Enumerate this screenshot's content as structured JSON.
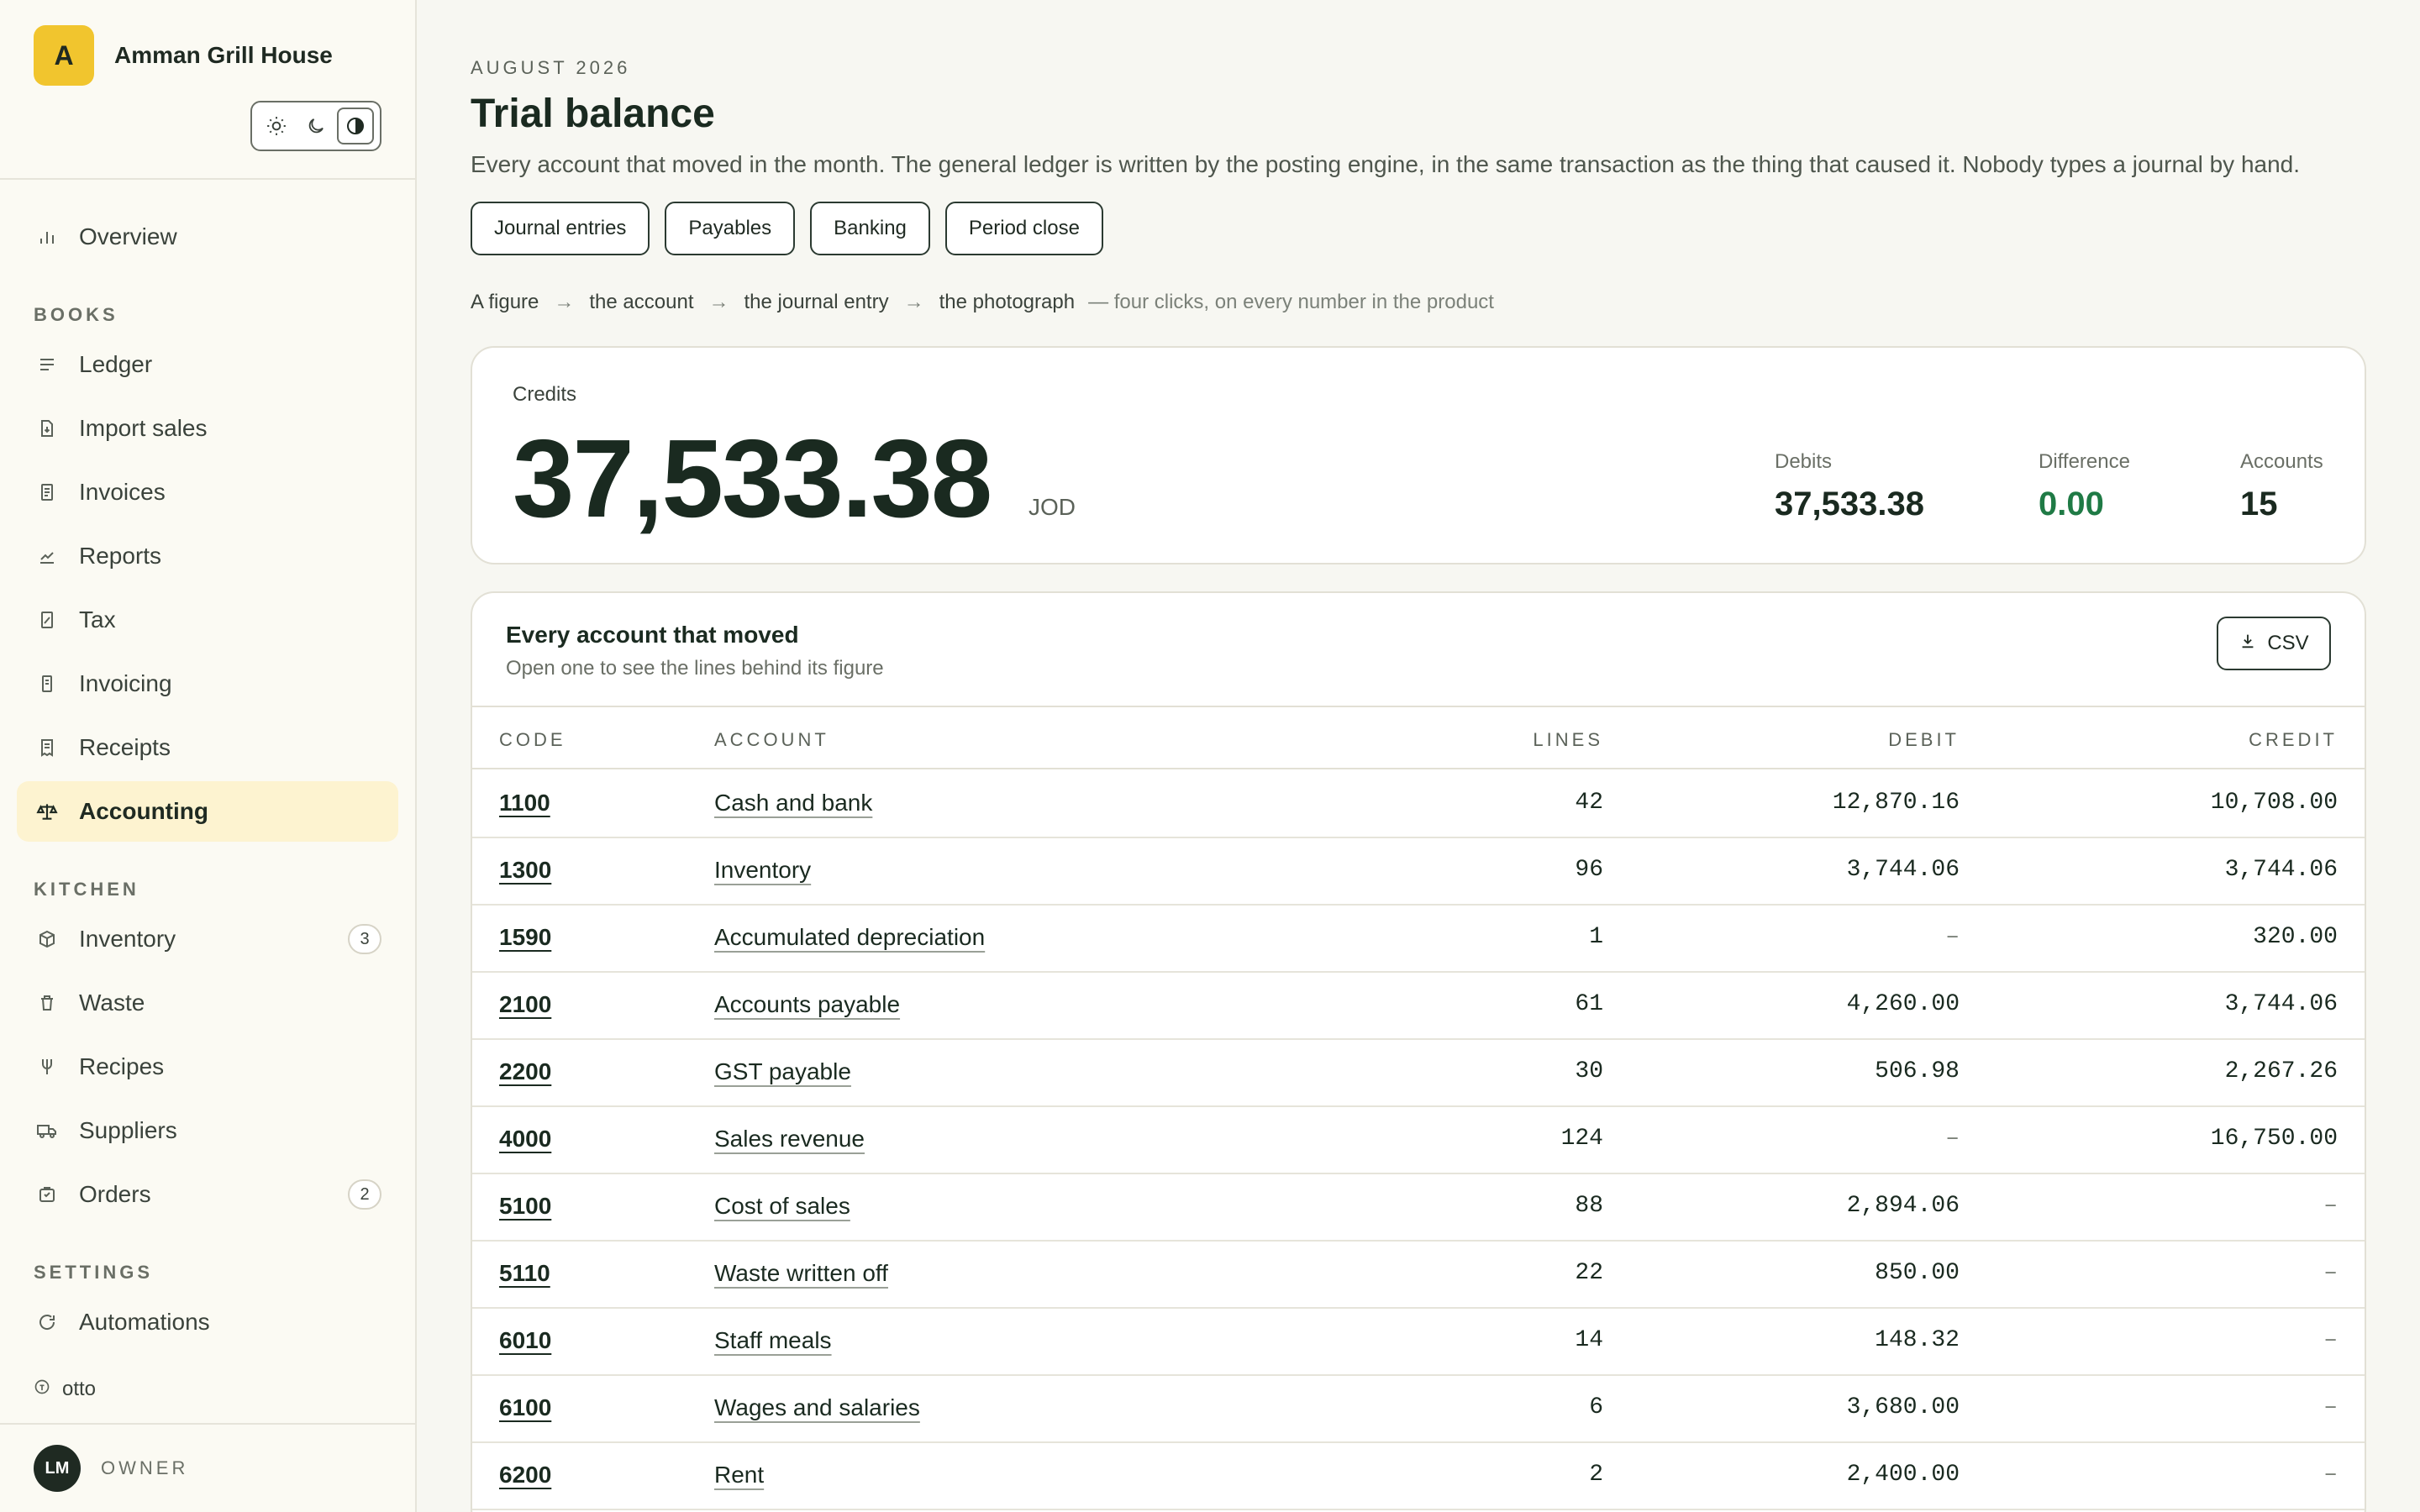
{
  "brand": {
    "initial": "A",
    "name": "Amman Grill House"
  },
  "theme_switch": [
    "sun-icon",
    "moon-icon",
    "contrast-icon"
  ],
  "sidebar": {
    "overview": "Overview",
    "sections": {
      "books": "BOOKS",
      "kitchen": "KITCHEN",
      "settings": "SETTINGS"
    },
    "books_items": [
      {
        "label": "Ledger",
        "icon": "lines-icon"
      },
      {
        "label": "Import sales",
        "icon": "file-import-icon"
      },
      {
        "label": "Invoices",
        "icon": "document-icon"
      },
      {
        "label": "Reports",
        "icon": "trend-chart-icon"
      },
      {
        "label": "Tax",
        "icon": "tax-document-icon"
      },
      {
        "label": "Invoicing",
        "icon": "receipt-stack-icon"
      },
      {
        "label": "Receipts",
        "icon": "receipt-icon"
      },
      {
        "label": "Accounting",
        "icon": "scale-icon",
        "active": true
      }
    ],
    "kitchen_items": [
      {
        "label": "Inventory",
        "icon": "box-icon",
        "badge": "3"
      },
      {
        "label": "Waste",
        "icon": "trash-icon"
      },
      {
        "label": "Recipes",
        "icon": "fork-icon"
      },
      {
        "label": "Suppliers",
        "icon": "truck-icon"
      },
      {
        "label": "Orders",
        "icon": "basket-icon",
        "badge": "2"
      }
    ],
    "settings_items": [
      {
        "label": "Automations",
        "icon": "refresh-icon"
      }
    ],
    "otto": "otto",
    "user": {
      "initials": "LM",
      "role": "OWNER"
    }
  },
  "page": {
    "eyebrow": "AUGUST 2026",
    "title": "Trial balance",
    "description": "Every account that moved in the month. The general ledger is written by the posting engine, in the same transaction as the thing that caused it. Nobody types a journal by hand.",
    "tabs": [
      "Journal entries",
      "Payables",
      "Banking",
      "Period close"
    ],
    "trail": [
      "A figure",
      "the account",
      "the journal entry",
      "the photograph"
    ],
    "trail_note": "— four clicks, on every number in the product"
  },
  "summary": {
    "credits_label": "Credits",
    "credits_value": "37,533.38",
    "currency": "JOD",
    "debits_label": "Debits",
    "debits_value": "37,533.38",
    "difference_label": "Difference",
    "difference_value": "0.00",
    "accounts_label": "Accounts",
    "accounts_value": "15"
  },
  "table": {
    "title": "Every account that moved",
    "subtitle": "Open one to see the lines behind its figure",
    "csv_label": "CSV",
    "headers": {
      "code": "CODE",
      "account": "ACCOUNT",
      "lines": "LINES",
      "debit": "DEBIT",
      "credit": "CREDIT"
    },
    "rows": [
      {
        "code": "1100",
        "account": "Cash and bank",
        "lines": "42",
        "debit": "12,870.16",
        "credit": "10,708.00"
      },
      {
        "code": "1300",
        "account": "Inventory",
        "lines": "96",
        "debit": "3,744.06",
        "credit": "3,744.06"
      },
      {
        "code": "1590",
        "account": "Accumulated depreciation",
        "lines": "1",
        "debit": "–",
        "credit": "320.00"
      },
      {
        "code": "2100",
        "account": "Accounts payable",
        "lines": "61",
        "debit": "4,260.00",
        "credit": "3,744.06"
      },
      {
        "code": "2200",
        "account": "GST payable",
        "lines": "30",
        "debit": "506.98",
        "credit": "2,267.26"
      },
      {
        "code": "4000",
        "account": "Sales revenue",
        "lines": "124",
        "debit": "–",
        "credit": "16,750.00"
      },
      {
        "code": "5100",
        "account": "Cost of sales",
        "lines": "88",
        "debit": "2,894.06",
        "credit": "–"
      },
      {
        "code": "5110",
        "account": "Waste written off",
        "lines": "22",
        "debit": "850.00",
        "credit": "–"
      },
      {
        "code": "6010",
        "account": "Staff meals",
        "lines": "14",
        "debit": "148.32",
        "credit": "–"
      },
      {
        "code": "6100",
        "account": "Wages and salaries",
        "lines": "6",
        "debit": "3,680.00",
        "credit": "–"
      },
      {
        "code": "6200",
        "account": "Rent",
        "lines": "2",
        "debit": "2,400.00",
        "credit": "–"
      }
    ]
  },
  "colors": {
    "accent": "#f1c52e",
    "active_bg": "#fdf3d0",
    "positive": "#1f7a45",
    "ink": "#1a2a20"
  }
}
